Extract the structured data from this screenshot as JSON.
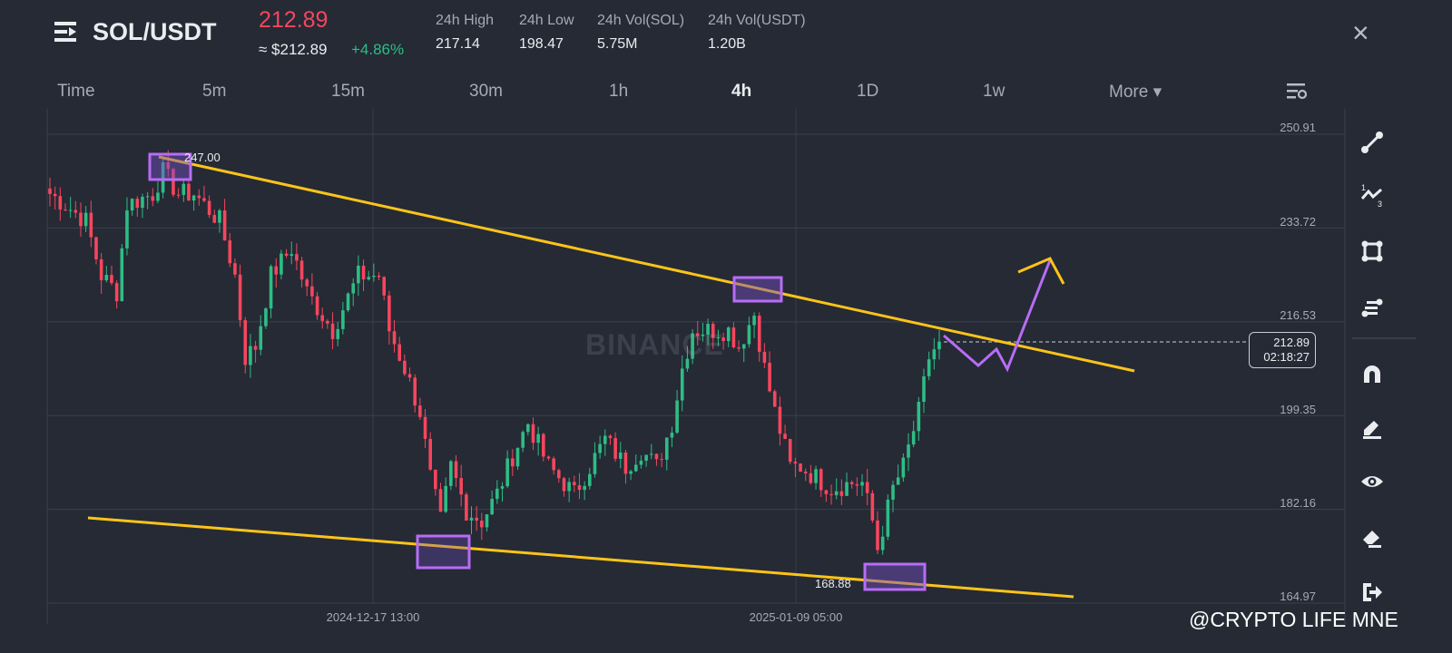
{
  "header": {
    "pair": "SOL/USDT",
    "last_price": "212.89",
    "usd_price": "≈ $212.89",
    "change": "+4.86%",
    "stats": [
      {
        "label": "24h High",
        "value": "217.14"
      },
      {
        "label": "24h Low",
        "value": "198.47"
      },
      {
        "label": "24h Vol(SOL)",
        "value": "5.75M"
      },
      {
        "label": "24h Vol(USDT)",
        "value": "1.20B"
      }
    ],
    "close_icon": "×"
  },
  "tabs": [
    {
      "label": "Time",
      "active": false
    },
    {
      "label": "5m",
      "active": false
    },
    {
      "label": "15m",
      "active": false
    },
    {
      "label": "30m",
      "active": false
    },
    {
      "label": "1h",
      "active": false
    },
    {
      "label": "4h",
      "active": true
    },
    {
      "label": "1D",
      "active": false
    },
    {
      "label": "1w",
      "active": false
    },
    {
      "label": "More ▾",
      "active": false
    }
  ],
  "toolbar": [
    "trend-line-icon",
    "fibonacci-icon",
    "rectangle-icon",
    "parallel-lines-icon",
    "magnet-icon",
    "pencil-icon",
    "eye-icon",
    "eraser-icon",
    "exit-icon"
  ],
  "chart_data": {
    "type": "candlestick",
    "y_ticks": [
      "250.91",
      "233.72",
      "216.53",
      "199.35",
      "182.16",
      "164.97"
    ],
    "ylim": [
      164.97,
      250.91
    ],
    "x_ticks": [
      "2024-12-17 13:00",
      "2025-01-09 05:00"
    ],
    "current_price": "212.89",
    "countdown": "02:18:27",
    "annotations": {
      "high": "247.00",
      "low": "168.88"
    },
    "close_path": [
      [
        0,
        240
      ],
      [
        3,
        238
      ],
      [
        7,
        235
      ],
      [
        10,
        225
      ],
      [
        13,
        222
      ],
      [
        15,
        238
      ],
      [
        20,
        240
      ],
      [
        22,
        244
      ],
      [
        25,
        240
      ],
      [
        28,
        240
      ],
      [
        33,
        235
      ],
      [
        36,
        225
      ],
      [
        38,
        210
      ],
      [
        40,
        212
      ],
      [
        43,
        225
      ],
      [
        47,
        230
      ],
      [
        50,
        222
      ],
      [
        55,
        215
      ],
      [
        60,
        225
      ],
      [
        64,
        225
      ],
      [
        66,
        215
      ],
      [
        69,
        208
      ],
      [
        72,
        200
      ],
      [
        74,
        188
      ],
      [
        76,
        180
      ],
      [
        78,
        190
      ],
      [
        81,
        182
      ],
      [
        84,
        180
      ],
      [
        87,
        185
      ],
      [
        90,
        192
      ],
      [
        93,
        198
      ],
      [
        97,
        190
      ],
      [
        99,
        188
      ],
      [
        102,
        185
      ],
      [
        105,
        190
      ],
      [
        108,
        195
      ],
      [
        112,
        190
      ],
      [
        115,
        193
      ],
      [
        118,
        190
      ],
      [
        121,
        198
      ],
      [
        123,
        208
      ],
      [
        125,
        215
      ],
      [
        129,
        215
      ],
      [
        132,
        215
      ],
      [
        134,
        212
      ],
      [
        137,
        218
      ],
      [
        139,
        208
      ],
      [
        141,
        200
      ],
      [
        144,
        190
      ],
      [
        146,
        190
      ],
      [
        149,
        188
      ],
      [
        152,
        186
      ],
      [
        156,
        187
      ],
      [
        158,
        187
      ],
      [
        160,
        180
      ],
      [
        161,
        175
      ],
      [
        164,
        186
      ],
      [
        166,
        190
      ],
      [
        169,
        200
      ],
      [
        171,
        210
      ],
      [
        173,
        213
      ]
    ],
    "watermark": "BINANCE"
  },
  "credit": "@CRYPTO LIFE MNE",
  "colors": {
    "up": "#2ebd85",
    "down": "#f6465d",
    "trend": "#fcc419",
    "marker": "#b86cf5",
    "bg": "#252a35"
  }
}
